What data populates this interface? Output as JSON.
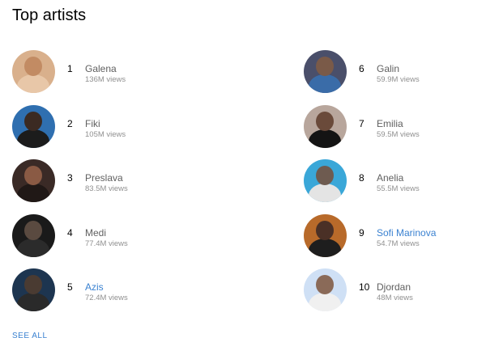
{
  "header": {
    "title": "Top artists"
  },
  "artists_left": [
    {
      "rank": "1",
      "name": "Galena",
      "views": "136M views",
      "link": false,
      "bg": "#d9b08c",
      "head": "#c28b63",
      "body": "#e8c7a8"
    },
    {
      "rank": "2",
      "name": "Fiki",
      "views": "105M views",
      "link": false,
      "bg": "#2f6fb0",
      "head": "#3b2a22",
      "body": "#1c1c1c"
    },
    {
      "rank": "3",
      "name": "Preslava",
      "views": "83.5M views",
      "link": false,
      "bg": "#3a2a26",
      "head": "#8a5a44",
      "body": "#201816"
    },
    {
      "rank": "4",
      "name": "Medi",
      "views": "77.4M views",
      "link": false,
      "bg": "#1a1a1a",
      "head": "#5a4a40",
      "body": "#2b2b2b"
    },
    {
      "rank": "5",
      "name": "Azis",
      "views": "72.4M views",
      "link": true,
      "bg": "#1d3550",
      "head": "#4a3b32",
      "body": "#2a2a2a"
    }
  ],
  "artists_right": [
    {
      "rank": "6",
      "name": "Galin",
      "views": "59.9M views",
      "link": false,
      "bg": "#4a4f6a",
      "head": "#7a5a48",
      "body": "#3a6ca8"
    },
    {
      "rank": "7",
      "name": "Emilia",
      "views": "59.5M views",
      "link": false,
      "bg": "#b8a69c",
      "head": "#6a4a3a",
      "body": "#141414"
    },
    {
      "rank": "8",
      "name": "Anelia",
      "views": "55.5M views",
      "link": false,
      "bg": "#3aa7d8",
      "head": "#6e5b50",
      "body": "#e4e4e4"
    },
    {
      "rank": "9",
      "name": "Sofi Marinova",
      "views": "54.7M views",
      "link": true,
      "bg": "#b86a2a",
      "head": "#4a3026",
      "body": "#1e1e1e"
    },
    {
      "rank": "10",
      "name": "Djordan",
      "views": "48M views",
      "link": false,
      "bg": "#cfe0f5",
      "head": "#8a6a58",
      "body": "#f0f0f0"
    }
  ],
  "footer": {
    "see_all": "SEE ALL"
  }
}
